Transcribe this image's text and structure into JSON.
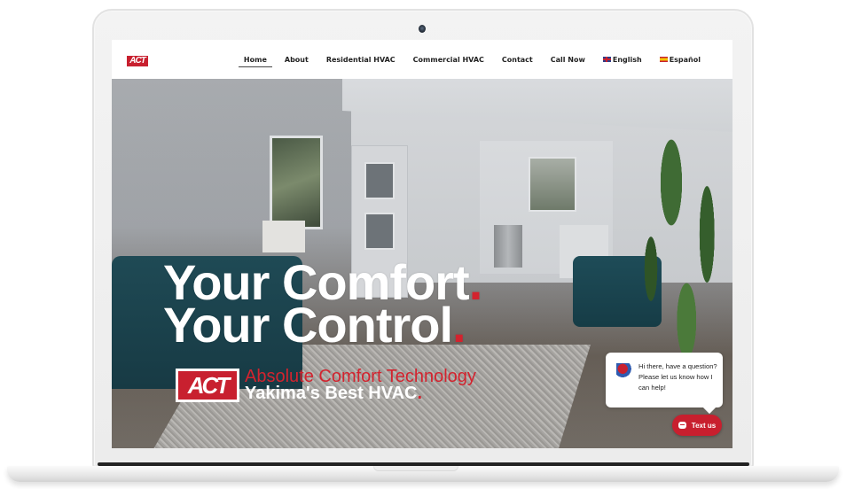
{
  "nav": {
    "logo_text": "ACT",
    "items": [
      {
        "label": "Home",
        "active": true
      },
      {
        "label": "About"
      },
      {
        "label": "Residential HVAC"
      },
      {
        "label": "Commercial HVAC"
      },
      {
        "label": "Contact"
      },
      {
        "label": "Call Now"
      },
      {
        "label": "English",
        "icon": "uk-flag-icon"
      },
      {
        "label": "Español",
        "icon": "spain-flag-icon"
      }
    ]
  },
  "hero": {
    "line1": "Your Comfort",
    "line2": "Your Control",
    "dot": ".",
    "brand_logo_text": "ACT",
    "brand_name": "Absolute Comfort Technology",
    "brand_tagline": "Yakima's Best HVAC"
  },
  "chat": {
    "message": "Hi there, have a question? Please let us know how I can help!",
    "button_label": "Text us"
  },
  "colors": {
    "accent_red": "#c8202f"
  }
}
